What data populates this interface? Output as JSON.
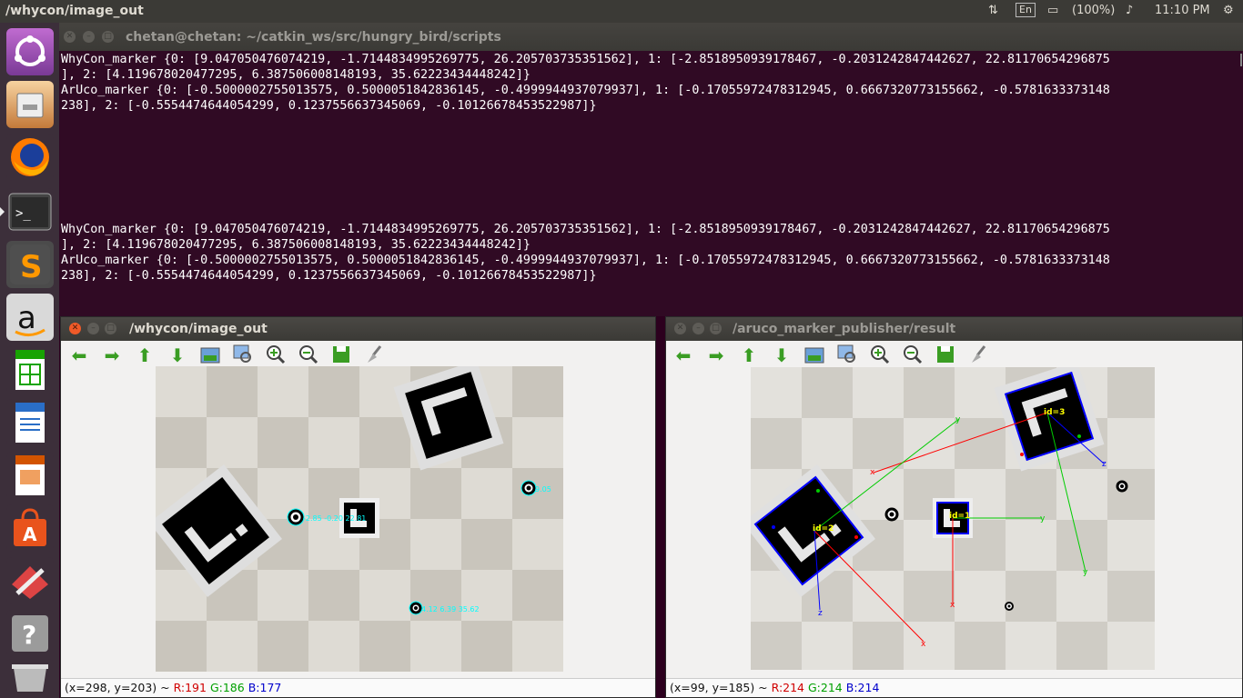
{
  "panel": {
    "window_title": "/whycon/image_out",
    "keyboard": "En",
    "battery": "(100%)",
    "time": "11:10 PM"
  },
  "launcher": {
    "items": [
      "Ubuntu Dash",
      "Files",
      "Firefox",
      "Terminal",
      "Sublime Text",
      "Amazon",
      "LibreOffice Calc",
      "LibreOffice Writer",
      "LibreOffice Impress",
      "Ubuntu Software",
      "System Settings",
      "Help",
      "Trash"
    ]
  },
  "terminal": {
    "title": "chetan@chetan: ~/catkin_ws/src/hungry_bird/scripts",
    "lines": [
      "WhyCon_marker {0: [9.047050476074219, -1.7144834995269775, 26.205703735351562], 1: [-2.8518950939178467, -0.2031242847442627, 22.81170654296875",
      "], 2: [4.119678020477295, 6.387506008148193, 35.62223434448242]}",
      "ArUco_marker {0: [-0.5000002755013575, 0.5000051842836145, -0.4999944937079937], 1: [-0.17055972478312945, 0.6667320773155662, -0.5781633373148",
      "238], 2: [-0.5554474644054299, 0.1237556637345069, -0.10126678453522987]}",
      "",
      "",
      "",
      "",
      "",
      "",
      "",
      "WhyCon_marker {0: [9.047050476074219, -1.7144834995269775, 26.205703735351562], 1: [-2.8518950939178467, -0.2031242847442627, 22.81170654296875",
      "], 2: [4.119678020477295, 6.387506008148193, 35.62223434448242]}",
      "ArUco_marker {0: [-0.5000002755013575, 0.5000051842836145, -0.4999944937079937], 1: [-0.17055972478312945, 0.6667320773155662, -0.5781633373148",
      "238], 2: [-0.5554474644054299, 0.1237556637345069, -0.10126678453522987]}"
    ]
  },
  "whycon_window": {
    "title": "/whycon/image_out",
    "status_prefix": "(x=298, y=203) ~ ",
    "r": "R:191",
    "g": "G:186",
    "b": "B:177",
    "label_1": "-2.85 -0.20 22.81",
    "label_2": "9.05",
    "label_3": "4.12 6.39 35.62"
  },
  "aruco_window": {
    "title": "/aruco_marker_publisher/result",
    "status_prefix": "(x=99, y=185) ~ ",
    "r": "R:214",
    "g": "G:214",
    "b": "B:214",
    "id_3": "id=3",
    "id_2": "id=2",
    "id_1": "id=1",
    "axis_x": "x",
    "axis_y": "y",
    "axis_z": "z"
  },
  "colors": {
    "terminal_bg": "#300a24",
    "panel_bg": "#3b3a36",
    "accent_close": "#f05a28",
    "label_cyan": "#00ffff",
    "id_yellow": "#ffff00"
  }
}
